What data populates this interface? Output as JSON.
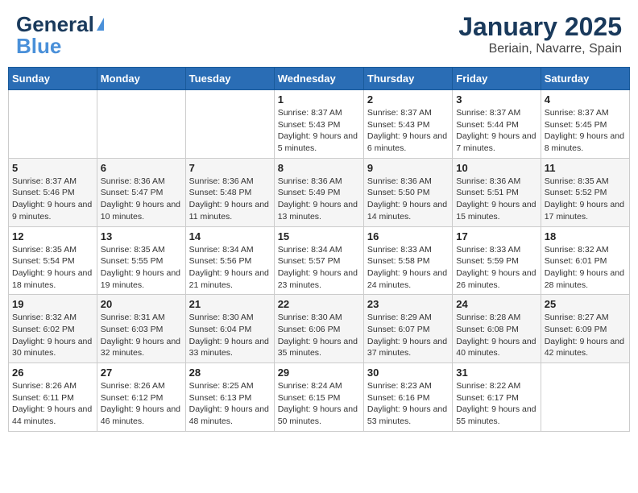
{
  "header": {
    "logo_line1": "General",
    "logo_line2": "Blue",
    "title": "January 2025",
    "subtitle": "Beriain, Navarre, Spain"
  },
  "weekdays": [
    "Sunday",
    "Monday",
    "Tuesday",
    "Wednesday",
    "Thursday",
    "Friday",
    "Saturday"
  ],
  "weeks": [
    [
      {
        "day": "",
        "info": ""
      },
      {
        "day": "",
        "info": ""
      },
      {
        "day": "",
        "info": ""
      },
      {
        "day": "1",
        "info": "Sunrise: 8:37 AM\nSunset: 5:43 PM\nDaylight: 9 hours\nand 5 minutes."
      },
      {
        "day": "2",
        "info": "Sunrise: 8:37 AM\nSunset: 5:43 PM\nDaylight: 9 hours\nand 6 minutes."
      },
      {
        "day": "3",
        "info": "Sunrise: 8:37 AM\nSunset: 5:44 PM\nDaylight: 9 hours\nand 7 minutes."
      },
      {
        "day": "4",
        "info": "Sunrise: 8:37 AM\nSunset: 5:45 PM\nDaylight: 9 hours\nand 8 minutes."
      }
    ],
    [
      {
        "day": "5",
        "info": "Sunrise: 8:37 AM\nSunset: 5:46 PM\nDaylight: 9 hours\nand 9 minutes."
      },
      {
        "day": "6",
        "info": "Sunrise: 8:36 AM\nSunset: 5:47 PM\nDaylight: 9 hours\nand 10 minutes."
      },
      {
        "day": "7",
        "info": "Sunrise: 8:36 AM\nSunset: 5:48 PM\nDaylight: 9 hours\nand 11 minutes."
      },
      {
        "day": "8",
        "info": "Sunrise: 8:36 AM\nSunset: 5:49 PM\nDaylight: 9 hours\nand 13 minutes."
      },
      {
        "day": "9",
        "info": "Sunrise: 8:36 AM\nSunset: 5:50 PM\nDaylight: 9 hours\nand 14 minutes."
      },
      {
        "day": "10",
        "info": "Sunrise: 8:36 AM\nSunset: 5:51 PM\nDaylight: 9 hours\nand 15 minutes."
      },
      {
        "day": "11",
        "info": "Sunrise: 8:35 AM\nSunset: 5:52 PM\nDaylight: 9 hours\nand 17 minutes."
      }
    ],
    [
      {
        "day": "12",
        "info": "Sunrise: 8:35 AM\nSunset: 5:54 PM\nDaylight: 9 hours\nand 18 minutes."
      },
      {
        "day": "13",
        "info": "Sunrise: 8:35 AM\nSunset: 5:55 PM\nDaylight: 9 hours\nand 19 minutes."
      },
      {
        "day": "14",
        "info": "Sunrise: 8:34 AM\nSunset: 5:56 PM\nDaylight: 9 hours\nand 21 minutes."
      },
      {
        "day": "15",
        "info": "Sunrise: 8:34 AM\nSunset: 5:57 PM\nDaylight: 9 hours\nand 23 minutes."
      },
      {
        "day": "16",
        "info": "Sunrise: 8:33 AM\nSunset: 5:58 PM\nDaylight: 9 hours\nand 24 minutes."
      },
      {
        "day": "17",
        "info": "Sunrise: 8:33 AM\nSunset: 5:59 PM\nDaylight: 9 hours\nand 26 minutes."
      },
      {
        "day": "18",
        "info": "Sunrise: 8:32 AM\nSunset: 6:01 PM\nDaylight: 9 hours\nand 28 minutes."
      }
    ],
    [
      {
        "day": "19",
        "info": "Sunrise: 8:32 AM\nSunset: 6:02 PM\nDaylight: 9 hours\nand 30 minutes."
      },
      {
        "day": "20",
        "info": "Sunrise: 8:31 AM\nSunset: 6:03 PM\nDaylight: 9 hours\nand 32 minutes."
      },
      {
        "day": "21",
        "info": "Sunrise: 8:30 AM\nSunset: 6:04 PM\nDaylight: 9 hours\nand 33 minutes."
      },
      {
        "day": "22",
        "info": "Sunrise: 8:30 AM\nSunset: 6:06 PM\nDaylight: 9 hours\nand 35 minutes."
      },
      {
        "day": "23",
        "info": "Sunrise: 8:29 AM\nSunset: 6:07 PM\nDaylight: 9 hours\nand 37 minutes."
      },
      {
        "day": "24",
        "info": "Sunrise: 8:28 AM\nSunset: 6:08 PM\nDaylight: 9 hours\nand 40 minutes."
      },
      {
        "day": "25",
        "info": "Sunrise: 8:27 AM\nSunset: 6:09 PM\nDaylight: 9 hours\nand 42 minutes."
      }
    ],
    [
      {
        "day": "26",
        "info": "Sunrise: 8:26 AM\nSunset: 6:11 PM\nDaylight: 9 hours\nand 44 minutes."
      },
      {
        "day": "27",
        "info": "Sunrise: 8:26 AM\nSunset: 6:12 PM\nDaylight: 9 hours\nand 46 minutes."
      },
      {
        "day": "28",
        "info": "Sunrise: 8:25 AM\nSunset: 6:13 PM\nDaylight: 9 hours\nand 48 minutes."
      },
      {
        "day": "29",
        "info": "Sunrise: 8:24 AM\nSunset: 6:15 PM\nDaylight: 9 hours\nand 50 minutes."
      },
      {
        "day": "30",
        "info": "Sunrise: 8:23 AM\nSunset: 6:16 PM\nDaylight: 9 hours\nand 53 minutes."
      },
      {
        "day": "31",
        "info": "Sunrise: 8:22 AM\nSunset: 6:17 PM\nDaylight: 9 hours\nand 55 minutes."
      },
      {
        "day": "",
        "info": ""
      }
    ]
  ]
}
